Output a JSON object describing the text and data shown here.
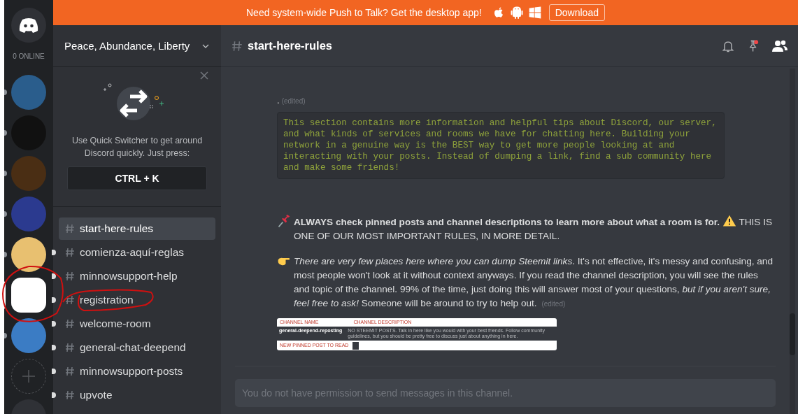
{
  "banner": {
    "text": "Need system-wide Push to Talk? Get the desktop app!",
    "button": "Download"
  },
  "rail": {
    "online": "0 ONLINE",
    "servers": [
      {
        "selected": false,
        "unread": true,
        "color": "#2a5d8c"
      },
      {
        "selected": false,
        "unread": true,
        "color": "#111111"
      },
      {
        "selected": false,
        "unread": true,
        "color": "#4a2e14"
      },
      {
        "selected": false,
        "unread": true,
        "color": "#2b3a8f"
      },
      {
        "selected": false,
        "unread": true,
        "color": "#e8c070"
      },
      {
        "selected": true,
        "unread": false,
        "color": "#ffffff"
      },
      {
        "selected": false,
        "unread": true,
        "color": "#3b7cc4"
      }
    ]
  },
  "server": {
    "name": "Peace, Abundance, Liberty"
  },
  "quick_switcher": {
    "text": "Use Quick Switcher to get around Discord quickly. Just press:",
    "key": "CTRL + K"
  },
  "channels": [
    {
      "name": "start-here-rules",
      "selected": true,
      "unread": false
    },
    {
      "name": "comienza-aquí-reglas",
      "selected": false,
      "unread": true
    },
    {
      "name": "minnowsupport-help",
      "selected": false,
      "unread": true
    },
    {
      "name": "registration",
      "selected": false,
      "unread": true
    },
    {
      "name": "welcome-room",
      "selected": false,
      "unread": true
    },
    {
      "name": "general-chat-deepend",
      "selected": false,
      "unread": true
    },
    {
      "name": "minnowsupport-posts",
      "selected": false,
      "unread": true
    },
    {
      "name": "upvote",
      "selected": false,
      "unread": true
    }
  ],
  "header": {
    "channel": "start-here-rules"
  },
  "messages": [
    {
      "kind": "edited",
      "text": ".",
      "edited": "(edited)"
    },
    {
      "kind": "code",
      "text": "This section contains more information and helpful tips about Discord, our server, and what kinds of services and rooms we have for chatting here. Building your network in a genuine way is the BEST way to get more people looking at and interacting with your posts. Instead of dumping a link, find a sub community here and make some friends!"
    },
    {
      "kind": "rule",
      "lead": "**ALWAYS check pinned posts and channel descriptions to learn more about what a room is for.**",
      "tail": "THIS IS ONE OF OUR MOST IMPORTANT RULES, IN MORE DETAIL."
    },
    {
      "kind": "tip",
      "text": "*There are very few places here where you can dump Steemit links*. It's not effective, it's messy and confusing, and most people won't look at it without context anyways. If you read the channel description, you will see the rules and topic of the channel. 99% of the time, just doing this will answer most of your questions, *but if you aren't sure, feel free to ask!* Someone will be around to try to help out.",
      "edited": "(edited)"
    },
    {
      "kind": "image",
      "col_1": "CHANNEL NAME",
      "col_2": "CHANNEL DESCRIPTION",
      "channel": "general-deepend-reposting",
      "description": "NO STEEMIT POSTS. Talk in here like you would with your best friends. Follow community guidelines, but you should be pretty free to discuss just about anything in here.",
      "footer": "NEW PINNED POST TO READ"
    }
  ],
  "composer": {
    "placeholder": "You do not have permission to send messages in this channel."
  }
}
